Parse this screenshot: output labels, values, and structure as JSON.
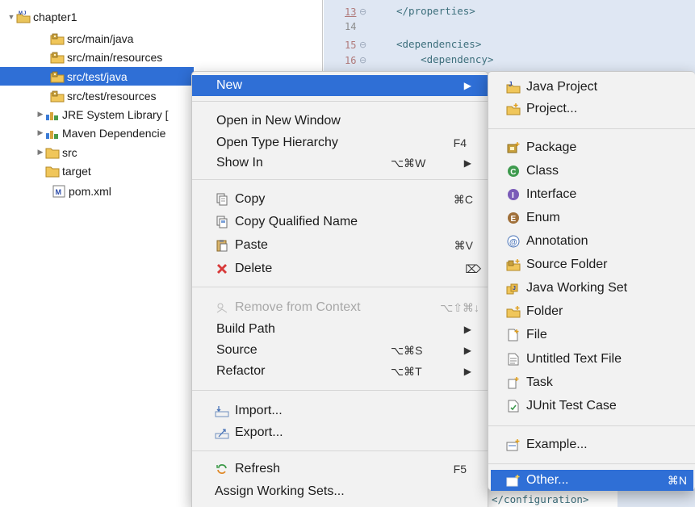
{
  "tree": {
    "items": [
      {
        "label": "chapter1",
        "icon": "maven-project-icon",
        "expanded": true
      },
      {
        "label": "src/main/java",
        "icon": "source-folder-icon"
      },
      {
        "label": "src/main/resources",
        "icon": "source-folder-icon"
      },
      {
        "label": "src/test/java",
        "icon": "source-folder-icon",
        "selected": true
      },
      {
        "label": "src/test/resources",
        "icon": "source-folder-icon"
      },
      {
        "label": "JRE System Library [",
        "icon": "library-icon",
        "collapsed": true
      },
      {
        "label": "Maven Dependencie",
        "icon": "library-icon",
        "collapsed": true
      },
      {
        "label": "src",
        "icon": "folder-icon",
        "collapsed": true
      },
      {
        "label": "target",
        "icon": "folder-icon"
      },
      {
        "label": "pom.xml",
        "icon": "xml-file-icon"
      }
    ]
  },
  "editor": {
    "lines": [
      {
        "num": "13",
        "code": "</properties>"
      },
      {
        "num": "14",
        "code": ""
      },
      {
        "num": "15",
        "code": "<dependencies>"
      },
      {
        "num": "16",
        "code": "    <dependency>"
      }
    ],
    "footer_code": "</configuration>"
  },
  "context_menu": {
    "new": {
      "label": "New"
    },
    "open_new_window": {
      "label": "Open in New Window"
    },
    "open_type_hierarchy": {
      "label": "Open Type Hierarchy",
      "shortcut": "F4"
    },
    "show_in": {
      "label": "Show In",
      "shortcut": "⌥⌘W"
    },
    "copy": {
      "label": "Copy",
      "shortcut": "⌘C"
    },
    "copy_qualified": {
      "label": "Copy Qualified Name"
    },
    "paste": {
      "label": "Paste",
      "shortcut": "⌘V"
    },
    "delete": {
      "label": "Delete",
      "shortcut": "⌦"
    },
    "remove_context": {
      "label": "Remove from Context",
      "shortcut": "⌥⇧⌘↓"
    },
    "build_path": {
      "label": "Build Path"
    },
    "source": {
      "label": "Source",
      "shortcut": "⌥⌘S"
    },
    "refactor": {
      "label": "Refactor",
      "shortcut": "⌥⌘T"
    },
    "import": {
      "label": "Import..."
    },
    "export": {
      "label": "Export..."
    },
    "refresh": {
      "label": "Refresh",
      "shortcut": "F5"
    },
    "assign_working_sets": {
      "label": "Assign Working Sets..."
    }
  },
  "submenu": {
    "java_project": "Java Project",
    "project": "Project...",
    "package": "Package",
    "class": "Class",
    "interface": "Interface",
    "enum": "Enum",
    "annotation": "Annotation",
    "source_folder": "Source Folder",
    "java_working_set": "Java Working Set",
    "folder": "Folder",
    "file": "File",
    "untitled_text_file": "Untitled Text File",
    "task": "Task",
    "junit_test_case": "JUnit Test Case",
    "example": "Example...",
    "other": {
      "label": "Other...",
      "shortcut": "⌘N"
    }
  },
  "colors": {
    "selection": "#2f6fd6",
    "menu_bg": "#f2f2f2",
    "editor_bg": "#dfe7f3",
    "code": "#3d6f7c",
    "delete_icon": "#d83a3a"
  }
}
